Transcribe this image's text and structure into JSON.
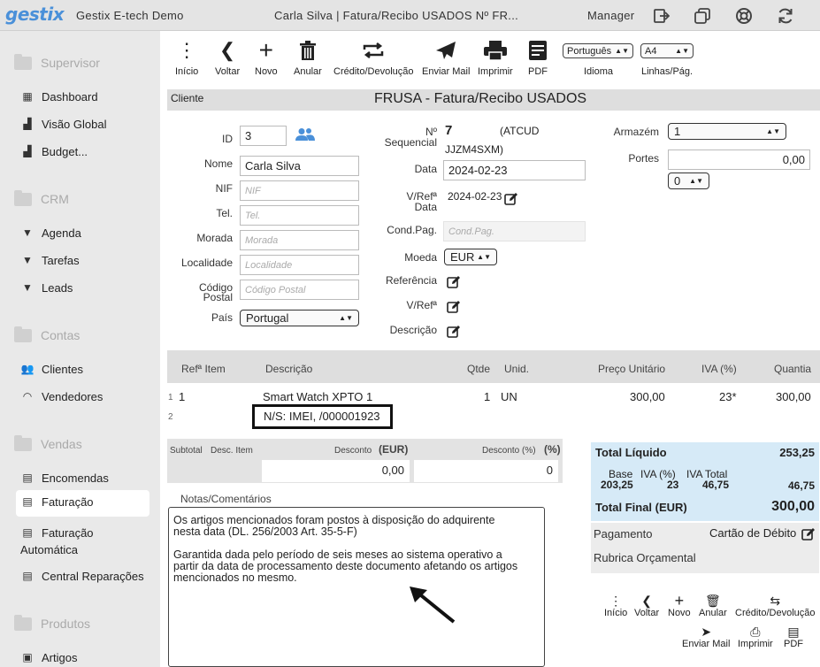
{
  "topbar": {
    "logo": "gestix",
    "company": "Gestix E-tech Demo",
    "document_title": "Carla Silva | Fatura/Recibo USADOS Nº FR...",
    "user_role": "Manager"
  },
  "sidebar": {
    "sections": {
      "supervisor": "Supervisor",
      "crm": "CRM",
      "contas": "Contas",
      "vendas": "Vendas",
      "produtos": "Produtos"
    },
    "items": {
      "dashboard": "Dashboard",
      "visao_global": "Visão Global",
      "budget": "Budget...",
      "agenda": "Agenda",
      "tarefas": "Tarefas",
      "leads": "Leads",
      "clientes": "Clientes",
      "vendedores": "Vendedores",
      "encomendas": "Encomendas",
      "faturacao": "Faturação",
      "faturacao_auto_1": "Faturação",
      "faturacao_auto_2": "Automática",
      "central_reparacoes": "Central Reparações",
      "artigos": "Artigos"
    }
  },
  "toolbar": {
    "inicio": "Início",
    "voltar": "Voltar",
    "novo": "Novo",
    "anular": "Anular",
    "credito": "Crédito/Devolução",
    "enviar_mail": "Enviar Mail",
    "imprimir": "Imprimir",
    "pdf": "PDF",
    "idioma_value": "Português",
    "idioma_label": "Idioma",
    "linhas_value": "A4",
    "linhas_label": "Linhas/Pág."
  },
  "header": {
    "client_label": "Cliente",
    "title": "FRUSA - Fatura/Recibo USADOS"
  },
  "client": {
    "id_label": "ID",
    "id_value": "3",
    "nome_label": "Nome",
    "nome_value": "Carla Silva",
    "nif_label": "NIF",
    "nif_placeholder": "NIF",
    "tel_label": "Tel.",
    "tel_placeholder": "Tel.",
    "morada_label": "Morada",
    "morada_placeholder": "Morada",
    "localidade_label": "Localidade",
    "localidade_placeholder": "Localidade",
    "codigo_label_1": "Código",
    "codigo_label_2": "Postal",
    "codigo_placeholder": "Código Postal",
    "pais_label": "País",
    "pais_value": "Portugal"
  },
  "document": {
    "seq_label_1": "Nº",
    "seq_label_2": "Sequencial",
    "seq_value": "7",
    "atcud_1": "(ATCUD",
    "atcud_2": "JJZM4SXM)",
    "data_label": "Data",
    "data_value": "2024-02-23",
    "vref_data_label_1": "V/Refª",
    "vref_data_label_2": "Data",
    "vref_data_value": "2024-02-23",
    "cond_pag_label": "Cond.Pag.",
    "cond_pag_placeholder": "Cond.Pag.",
    "moeda_label": "Moeda",
    "moeda_value": "EUR",
    "referencia_label": "Referência",
    "vref_label": "V/Refª",
    "descricao_label": "Descrição"
  },
  "warehouse": {
    "armazem_label": "Armazém",
    "armazem_value": "1",
    "portes_label": "Portes",
    "portes_value": "0,00",
    "portes_iva": "0"
  },
  "table": {
    "headers": {
      "ref": "Refª Item",
      "desc": "Descrição",
      "qtde": "Qtde",
      "unid": "Unid.",
      "preco": "Preço Unitário",
      "iva": "IVA (%)",
      "quantia": "Quantia"
    },
    "rows": [
      {
        "num": "1",
        "ref": "1",
        "desc": "Smart Watch XPTO 1",
        "qtde": "1",
        "unid": "UN",
        "preco": "300,00",
        "iva": "23*",
        "quantia": "300,00"
      },
      {
        "num": "2",
        "desc": "N/S: IMEI, /000001923"
      }
    ]
  },
  "subtotal": {
    "subtotal_label": "Subtotal",
    "desc_item_label": "Desc. Item",
    "desconto_label": "Desconto",
    "eur_label": "(EUR)",
    "desconto_pct_label": "Desconto (%)",
    "pct_label": "(%)",
    "desconto_value": "0,00",
    "desconto_pct_value": "0"
  },
  "totals": {
    "liquido_label": "Total Líquido",
    "liquido_value": "253,25",
    "base_label": "Base",
    "iva_label": "IVA (%)",
    "iva_total_label": "IVA Total",
    "base_value": "203,25",
    "iva_value": "23",
    "iva_total_value": "46,75",
    "iva_sum": "46,75",
    "final_label": "Total Final (EUR)",
    "final_value": "300,00",
    "pagamento_label": "Pagamento",
    "pagamento_value": "Cartão de Débito",
    "rubrica_label": "Rubrica Orçamental"
  },
  "notes": {
    "label": "Notas/Comentários",
    "text": "Os artigos mencionados foram postos à disposição do adquirente\nnesta data (DL. 256/2003 Art. 35-5-F)\n\nGarantida dada pelo período de seis meses ao sistema operativo a\npartir da data de processamento deste documento afetando os artigos\nmencionados no mesmo."
  },
  "bottom_toolbar": {
    "inicio": "Início",
    "voltar": "Voltar",
    "novo": "Novo",
    "anular": "Anular",
    "credito": "Crédito/Devolução",
    "enviar_mail": "Enviar Mail",
    "imprimir": "Imprimir",
    "pdf": "PDF"
  },
  "colors": {
    "brand": "#4a90d9",
    "totals_bg": "#d6eaf7",
    "header_bg": "#dedede"
  }
}
